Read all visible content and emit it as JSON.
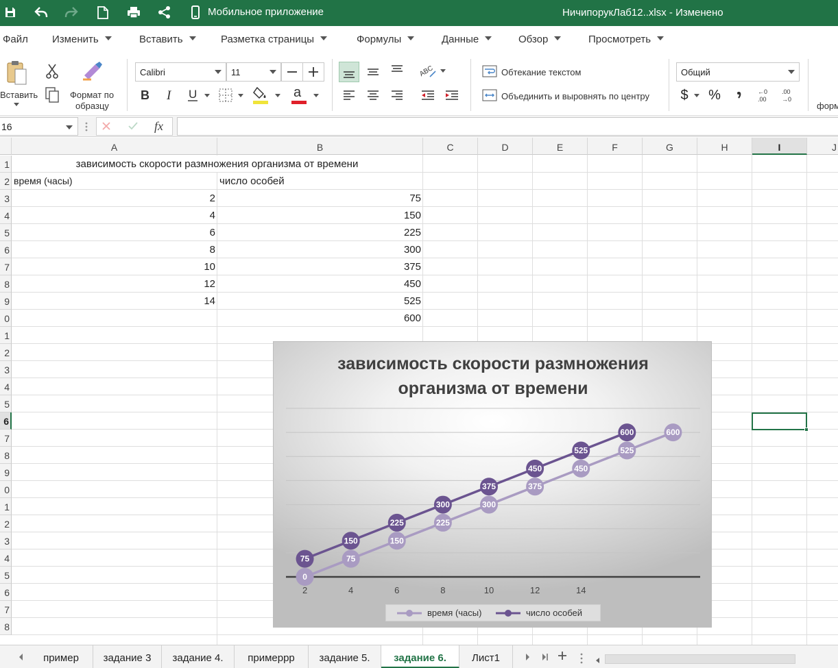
{
  "titlebar": {
    "mobile_label": "Мобильное приложение",
    "doc_title": "НичипорукЛаб12..xlsx - Изменено"
  },
  "menu": [
    "Файл",
    "Изменить",
    "Вставить",
    "Разметка страницы",
    "Формулы",
    "Данные",
    "Обзор",
    "Просмотреть"
  ],
  "ribbon": {
    "paste_label": "Вставить",
    "format_painter_label_1": "Формат по",
    "format_painter_label_2": "образцу",
    "font_name": "Calibri",
    "font_size": "11",
    "wrap_text": "Обтекание текстом",
    "merge_center": "Объединить и выровнять по центру",
    "number_format": "Общий",
    "currency_symbol": "$",
    "percent_symbol": "%",
    "comma_symbol": "❩",
    "truncated_label": "форм",
    "accent_green": "#217346"
  },
  "formula_bar": {
    "name_box": "16",
    "fx": "fx",
    "formula": ""
  },
  "grid": {
    "columns": [
      "A",
      "B",
      "C",
      "D",
      "E",
      "F",
      "G",
      "H",
      "I",
      "J"
    ],
    "selected_column": "I",
    "row_numbers": [
      "1",
      "2",
      "3",
      "4",
      "5",
      "6",
      "7",
      "8",
      "9",
      "0",
      "1",
      "2",
      "3",
      "4",
      "5",
      "6",
      "7",
      "8",
      "9",
      "0",
      "1",
      "2",
      "3",
      "4",
      "5",
      "6",
      "7",
      "8"
    ],
    "selected_row": "6",
    "title_cell": "зависимость скорости размножения организма от времени",
    "header_a": "время (часы)",
    "header_b": "число особей",
    "time_values": [
      "2",
      "4",
      "6",
      "8",
      "10",
      "12",
      "14"
    ],
    "count_values": [
      "75",
      "150",
      "225",
      "300",
      "375",
      "450",
      "525",
      "600"
    ]
  },
  "chart_data": {
    "type": "line",
    "title_line1": "зависимость скорости размножения",
    "title_line2": "организма от времени",
    "categories": [
      "2",
      "4",
      "6",
      "8",
      "10",
      "12",
      "14",
      "",
      ""
    ],
    "ylim": [
      0,
      700
    ],
    "grid": true,
    "legend_position": "bottom",
    "series": [
      {
        "name": "время (часы)",
        "color": "#a99bc2",
        "values": [
          0,
          75,
          150,
          225,
          300,
          375,
          450,
          525,
          600
        ],
        "labels": [
          "0",
          "75",
          "150",
          "225",
          "300",
          "375",
          "450",
          "525",
          "600"
        ]
      },
      {
        "name": "число особей",
        "color": "#6b5490",
        "values": [
          75,
          150,
          225,
          300,
          375,
          450,
          525,
          600
        ],
        "labels": [
          "75",
          "150",
          "225",
          "300",
          "375",
          "450",
          "525",
          "600"
        ]
      }
    ]
  },
  "tabs": {
    "items": [
      "пример",
      "задание 3",
      "задание 4.",
      "примеррр",
      "задание 5.",
      "задание 6.",
      "Лист1"
    ],
    "active": "задание 6."
  }
}
